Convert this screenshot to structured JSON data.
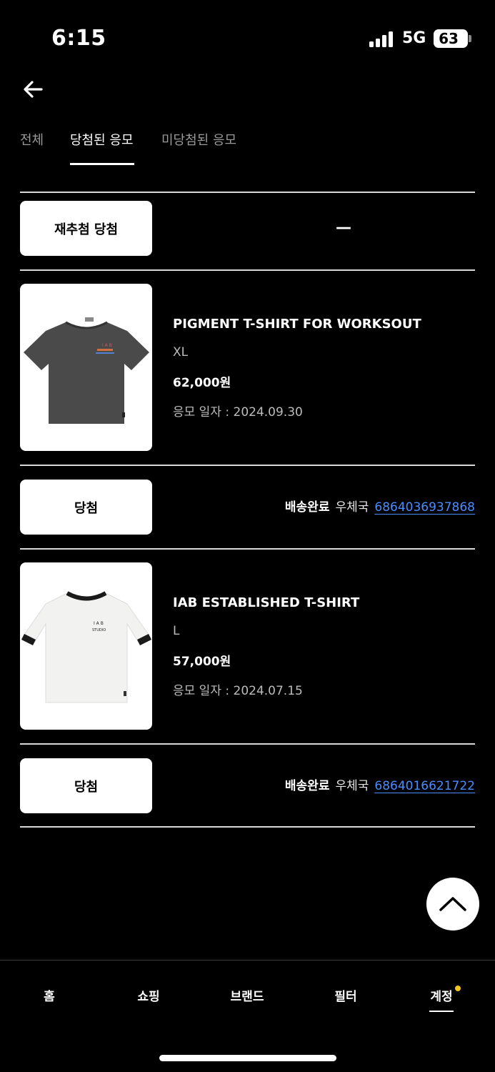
{
  "status_bar": {
    "time": "6:15",
    "network": "5G",
    "battery": "63"
  },
  "tabs": [
    {
      "label": "전체",
      "active": false
    },
    {
      "label": "당첨된 응모",
      "active": true
    },
    {
      "label": "미당첨된 응모",
      "active": false
    }
  ],
  "redraw_row": {
    "button_label": "재추첨 당첨",
    "value": "—"
  },
  "entries": [
    {
      "name": "PIGMENT T-SHIRT FOR WORKSOUT",
      "size": "XL",
      "price": "62,000원",
      "date_label": "응모 일자 : 2024.09.30",
      "result_label": "당첨",
      "delivery_status": "배송완료",
      "carrier": "우체국",
      "tracking_number": "6864036937868",
      "shirt_color": "#4a4a4a"
    },
    {
      "name": "IAB ESTABLISHED T-SHIRT",
      "size": "L",
      "price": "57,000원",
      "date_label": "응모 일자 : 2024.07.15",
      "result_label": "당첨",
      "delivery_status": "배송완료",
      "carrier": "우체국",
      "tracking_number": "6864016621722",
      "shirt_color": "#f4f4f2"
    }
  ],
  "bottom_nav": [
    {
      "label": "홈",
      "active": false
    },
    {
      "label": "쇼핑",
      "active": false
    },
    {
      "label": "브랜드",
      "active": false
    },
    {
      "label": "필터",
      "active": false
    },
    {
      "label": "계정",
      "active": true,
      "badge": true
    }
  ],
  "colors": {
    "background": "#000000",
    "link": "#4a8cff",
    "badge": "#f2c522"
  }
}
